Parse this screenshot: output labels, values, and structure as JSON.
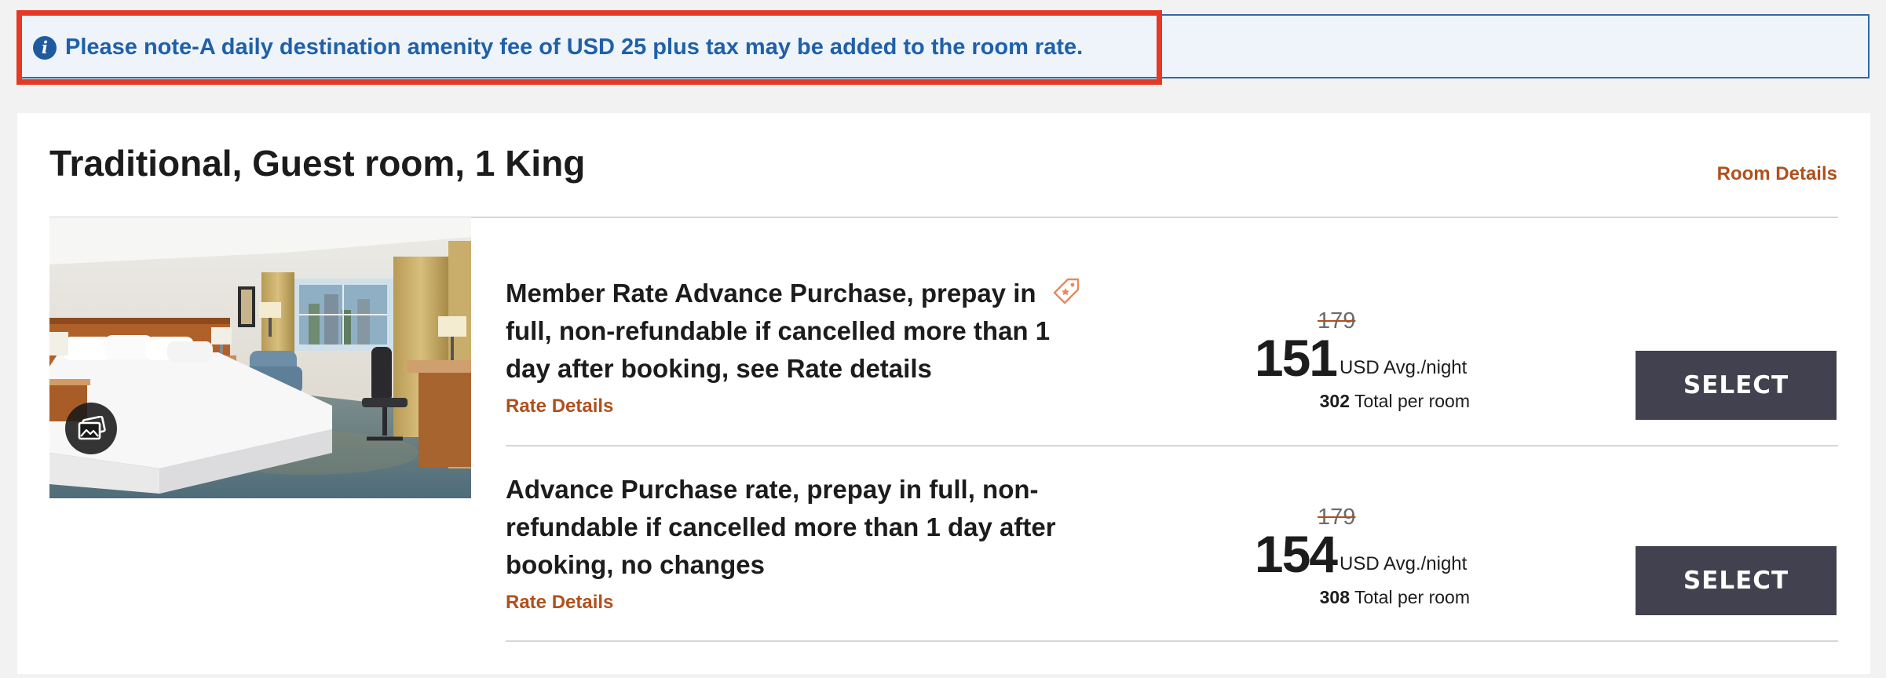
{
  "notice": {
    "icon": "info-icon",
    "icon_glyph": "i",
    "text": "Please note-A daily destination amenity fee of USD 25 plus tax may be added to the room rate.",
    "highlight_color": "#e53925"
  },
  "room": {
    "title": "Traditional, Guest room, 1 King",
    "details_link": "Room Details",
    "photo_icon": "gallery-icon"
  },
  "rates": [
    {
      "name": "Member Rate Advance Purchase, prepay in full, non-refundable if cancelled more than 1 day after booking, see Rate details",
      "details_link": "Rate Details",
      "badge_icon": "member-tag-icon",
      "original_price": "179",
      "price": "151",
      "price_unit": "USD Avg./night",
      "total": "302",
      "total_label": "Total per room",
      "select_label": "SELECT"
    },
    {
      "name": "Advance Purchase rate, prepay in full, non-refundable if cancelled more than 1 day after booking, no changes",
      "details_link": "Rate Details",
      "original_price": "179",
      "price": "154",
      "price_unit": "USD Avg./night",
      "total": "308",
      "total_label": "Total per room",
      "select_label": "SELECT"
    }
  ],
  "colors": {
    "link": "#b0501d",
    "notice_text": "#2060a8",
    "notice_bg": "#eef4fa",
    "button": "#42414f"
  }
}
